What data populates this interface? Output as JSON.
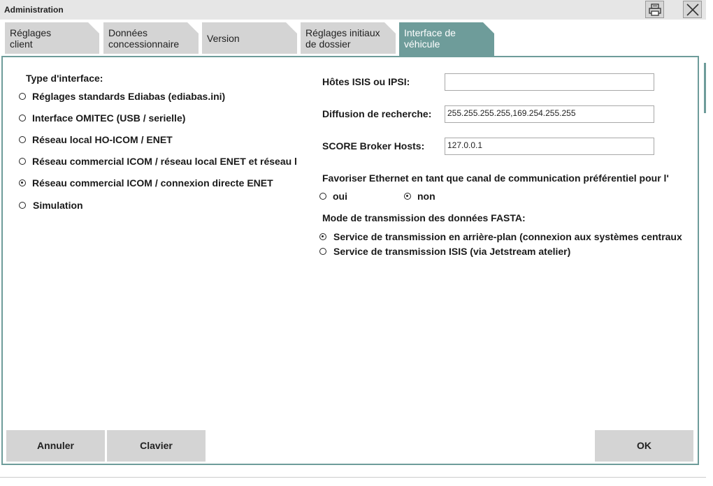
{
  "window": {
    "title": "Administration"
  },
  "tabs": [
    {
      "line1": "Réglages",
      "line2": "client"
    },
    {
      "line1": "Données",
      "line2": "concessionnaire"
    },
    {
      "line1": "Version",
      "line2": ""
    },
    {
      "line1": "Réglages initiaux",
      "line2": "de dossier"
    },
    {
      "line1": "Interface de",
      "line2": "véhicule"
    }
  ],
  "interface": {
    "heading": "Type d'interface:",
    "options": [
      {
        "label": "Réglages standards Ediabas (ediabas.ini)",
        "selected": false
      },
      {
        "label": "Interface OMITEC (USB / serielle)",
        "selected": false
      },
      {
        "label": "Réseau local HO-ICOM / ENET",
        "selected": false
      },
      {
        "label": "Réseau commercial ICOM / réseau local ENET et réseau l",
        "selected": false
      },
      {
        "label": "Réseau commercial ICOM / connexion directe ENET",
        "selected": true
      },
      {
        "label": "Simulation",
        "selected": false
      }
    ]
  },
  "fields": {
    "isis_hosts": {
      "label": "Hôtes ISIS ou IPSI:",
      "value": ""
    },
    "broadcast": {
      "label": "Diffusion de recherche:",
      "value": "255.255.255.255,169.254.255.255"
    },
    "score_hosts": {
      "label": "SCORE Broker Hosts:",
      "value": "127.0.0.1"
    }
  },
  "ethernet": {
    "question": "Favoriser Ethernet en tant que canal de communication préférentiel pour l'",
    "yes_label": "oui",
    "no_label": "non",
    "selected": "non"
  },
  "fasta": {
    "heading": "Mode de transmission des données FASTA:",
    "options": [
      {
        "label": "Service de transmission en arrière-plan (connexion aux systèmes centraux",
        "selected": true
      },
      {
        "label": "Service de transmission ISIS (via Jetstream atelier)",
        "selected": false
      }
    ]
  },
  "buttons": {
    "cancel": "Annuler",
    "keyboard": "Clavier",
    "ok": "OK"
  },
  "icons": {
    "print": "printer-icon",
    "close": "close-icon"
  },
  "colors": {
    "accent": "#6e9c9a",
    "tab_inactive": "#d4d4d4",
    "button": "#d4d4d4"
  }
}
